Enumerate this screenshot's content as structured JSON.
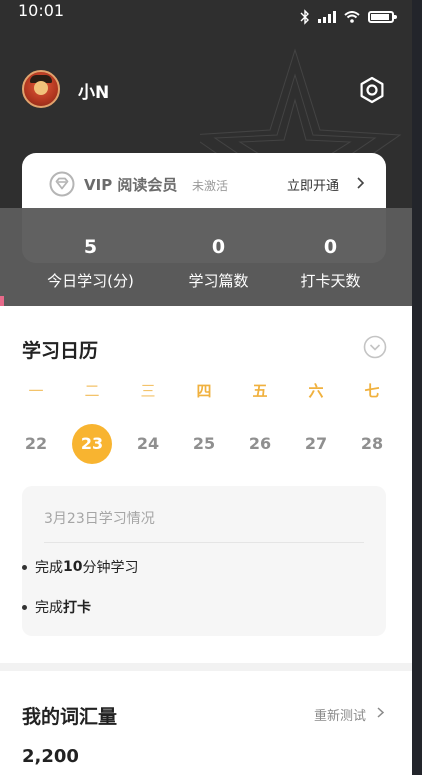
{
  "status_bar": {
    "time": "10:01"
  },
  "profile": {
    "name": "小N"
  },
  "vip": {
    "title": "VIP 阅读会员",
    "status": "未激活",
    "action": "立即开通"
  },
  "stats": [
    {
      "value": "5",
      "label": "今日学习(分)"
    },
    {
      "value": "0",
      "label": "学习篇数"
    },
    {
      "value": "0",
      "label": "打卡天数"
    }
  ],
  "calendar": {
    "title": "学习日历",
    "weekdays": [
      "一",
      "二",
      "三",
      "四",
      "五",
      "六",
      "七"
    ],
    "days": [
      "22",
      "23",
      "24",
      "25",
      "26",
      "27",
      "28"
    ],
    "selected_day": "23",
    "summary": {
      "title": "3月23日学习情况",
      "item1": {
        "prefix": "完成",
        "bold": "10",
        "suffix": "分钟学习"
      },
      "item2": {
        "prefix": "完成",
        "bold": "打卡"
      }
    }
  },
  "vocab": {
    "title": "我的词汇量",
    "retest": "重新测试",
    "count": "2,200"
  },
  "colors": {
    "accent": "#f8b430",
    "header_bg": "#2f2f2f",
    "weekday": "#f3c36a"
  }
}
